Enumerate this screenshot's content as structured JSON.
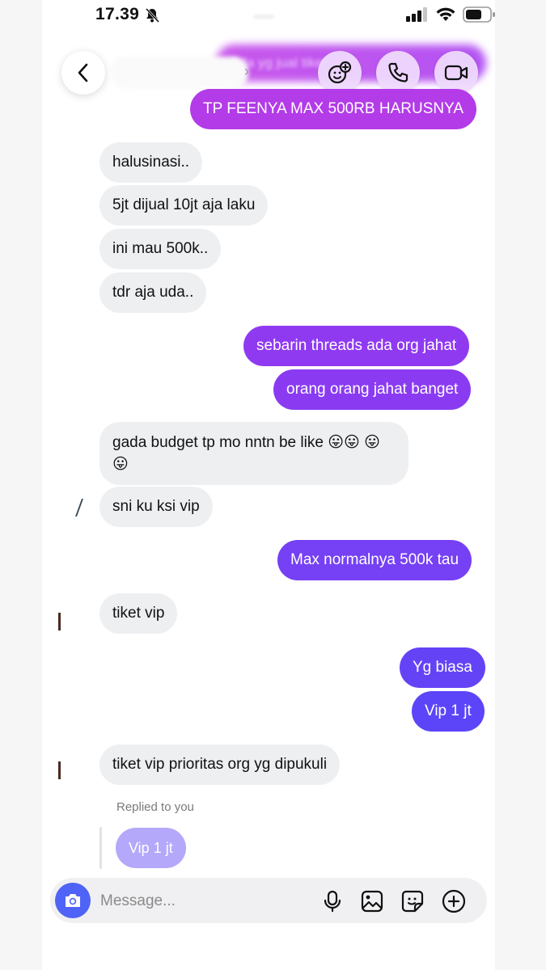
{
  "status_bar": {
    "time": "17.39"
  },
  "header": {
    "blurred_preview_text": "Ada yg jual tiket",
    "icons": [
      "back-chevron-icon",
      "effects-icon",
      "phone-icon",
      "video-camera-icon"
    ]
  },
  "messages": [
    {
      "from": "me",
      "text": "TP FEENYA MAX 500RB HARUSNYA"
    },
    {
      "from": "them",
      "text": "halusinasi.."
    },
    {
      "from": "them",
      "text": "5jt dijual 10jt aja laku"
    },
    {
      "from": "them",
      "text": "ini mau 500k.."
    },
    {
      "from": "them",
      "text": "tdr aja uda.."
    },
    {
      "from": "me",
      "text": "sebarin threads ada org jahat"
    },
    {
      "from": "me",
      "text": "orang orang jahat banget"
    },
    {
      "from": "them",
      "text": "gada budget tp mo nntn be like 😛😛 😛😛"
    },
    {
      "from": "them",
      "text": "sni ku ksi vip"
    },
    {
      "from": "me",
      "text": "Max normalnya 500k tau"
    },
    {
      "from": "them",
      "text": "tiket vip"
    },
    {
      "from": "me",
      "text": "Yg biasa"
    },
    {
      "from": "me",
      "text": "Vip 1 jt"
    },
    {
      "from": "them",
      "text": "tiket vip prioritas org yg dipukuli"
    }
  ],
  "reply": {
    "label": "Replied to you",
    "quoted": "Vip 1 jt"
  },
  "composer": {
    "placeholder": "Message...",
    "icons": [
      "camera-icon",
      "microphone-icon",
      "gallery-icon",
      "sticker-icon",
      "add-icon"
    ]
  },
  "colors": {
    "incoming": "#eeeff1",
    "outgoing_top": "#b33be8",
    "outgoing_bottom": "#5c45f8",
    "camera": "#4f63f7"
  }
}
